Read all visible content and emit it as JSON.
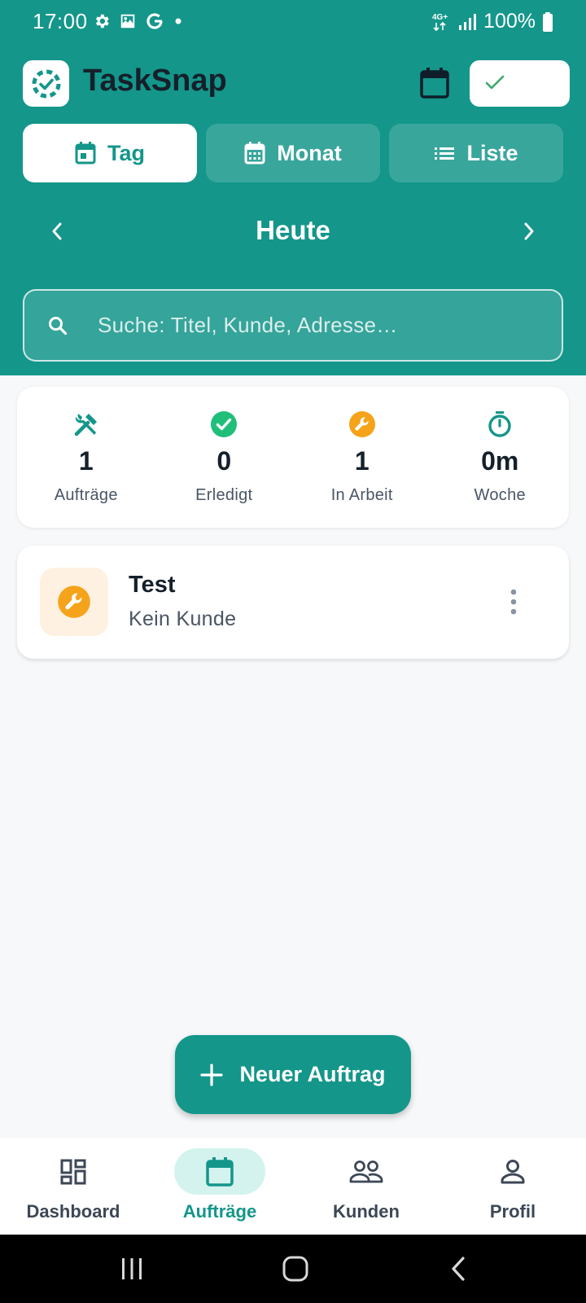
{
  "status_bar": {
    "time": "17:00",
    "left_icons": [
      "gear-icon",
      "image-icon",
      "google-icon",
      "dot-icon"
    ],
    "network": "4G+",
    "battery": "100%"
  },
  "app": {
    "title": "TaskSnap",
    "accent_color": "#14968a",
    "in_progress_color": "#f5a31a",
    "done_color": "#1fbf7a"
  },
  "tabs": [
    {
      "label": "Tag",
      "icon": "calendar-day-icon",
      "active": true
    },
    {
      "label": "Monat",
      "icon": "calendar-month-icon",
      "active": false
    },
    {
      "label": "Liste",
      "icon": "list-icon",
      "active": false
    }
  ],
  "date_nav": {
    "label": "Heute"
  },
  "search": {
    "placeholder": "Suche: Titel, Kunde, Adresse…",
    "value": ""
  },
  "stats": [
    {
      "value": "1",
      "label": "Aufträge",
      "icon": "tools-icon"
    },
    {
      "value": "0",
      "label": "Erledigt",
      "icon": "check-circle-icon"
    },
    {
      "value": "1",
      "label": "In Arbeit",
      "icon": "wrench-circle-icon"
    },
    {
      "value": "0m",
      "label": "Woche",
      "icon": "stopwatch-icon"
    }
  ],
  "jobs": [
    {
      "title": "Test",
      "subtitle": "Kein Kunde",
      "icon": "wrench-icon"
    }
  ],
  "fab": {
    "label": "Neuer Auftrag"
  },
  "bottom_nav": [
    {
      "label": "Dashboard",
      "icon": "dashboard-icon",
      "active": false
    },
    {
      "label": "Aufträge",
      "icon": "calendar-icon",
      "active": true
    },
    {
      "label": "Kunden",
      "icon": "people-icon",
      "active": false
    },
    {
      "label": "Profil",
      "icon": "person-icon",
      "active": false
    }
  ]
}
